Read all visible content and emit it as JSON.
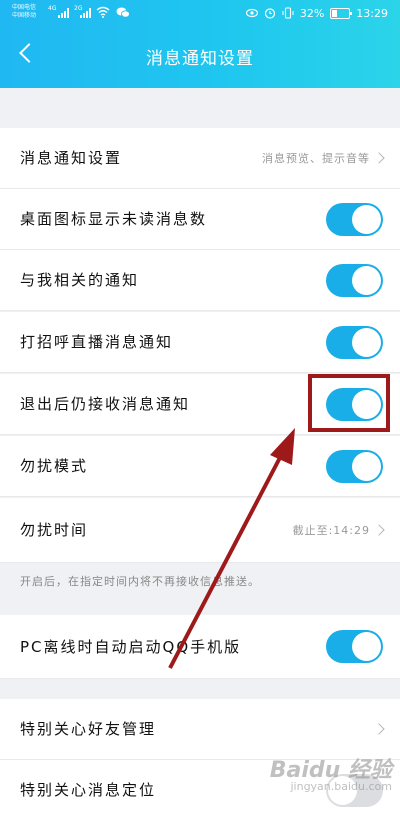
{
  "status_bar": {
    "carrier_1": "中国电信",
    "carrier_2": "中国移动",
    "net_4g": "4G",
    "net_2g": "2G",
    "battery": "32%",
    "time": "13:29"
  },
  "header": {
    "title": "消息通知设置"
  },
  "settings": [
    {
      "label": "消息通知设置",
      "value": "消息预览、提示音等",
      "type": "link"
    },
    {
      "label": "桌面图标显示未读消息数",
      "type": "toggle",
      "on": true
    },
    {
      "label": "与我相关的通知",
      "type": "toggle",
      "on": true
    },
    {
      "label": "打招呼直播消息通知",
      "type": "toggle",
      "on": true
    },
    {
      "label": "退出后仍接收消息通知",
      "type": "toggle",
      "on": true
    },
    {
      "label": "勿扰模式",
      "type": "toggle",
      "on": true
    },
    {
      "label": "勿扰时间",
      "value": "截止至:14:29",
      "type": "link"
    },
    {
      "label": "PC离线时自动启动QQ手机版",
      "type": "toggle",
      "on": true
    },
    {
      "label": "特别关心好友管理",
      "type": "link"
    },
    {
      "label": "特别关心消息定位",
      "type": "toggle",
      "on": false
    }
  ],
  "note": "开启后，在指定时间内将不再接收信息推送。",
  "watermark": {
    "main": "Baidu 经验",
    "sub": "jingyan.baidu.com"
  },
  "colors": {
    "accent": "#1aaee8",
    "header": "#20b8f2",
    "annotation": "#9e1a1a"
  }
}
